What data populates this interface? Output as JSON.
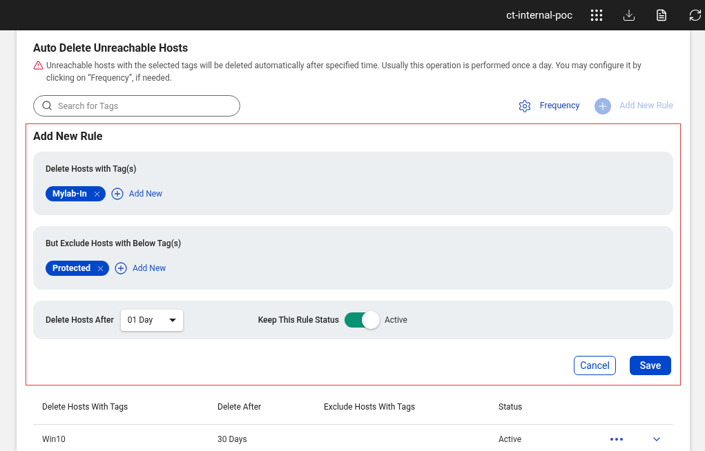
{
  "topbar": {
    "account": "ct-internal-poc"
  },
  "header": {
    "title": "Auto Delete Unreachable Hosts",
    "notice": "Unreachable hosts with the selected tags will be deleted automatically after specified time. Usually this operation is performed once a day. You may configure it by clicking on “Frequency”, if needed."
  },
  "search": {
    "placeholder": "Search for Tags"
  },
  "toolbar": {
    "frequency": "Frequency",
    "add_rule": {
      "label": "Add New Rule",
      "disabled": true
    }
  },
  "rule_form": {
    "title": "Add New Rule",
    "include_section": {
      "label": "Delete Hosts with Tag(s)",
      "tags": [
        "Mylab-In"
      ],
      "add_label": "Add New"
    },
    "exclude_section": {
      "label": "But Exclude Hosts with Below Tag(s)",
      "tags": [
        "Protected"
      ],
      "add_label": "Add New"
    },
    "delete_after": {
      "label": "Delete Hosts After",
      "value": "01 Day"
    },
    "status": {
      "label": "Keep This Rule Status",
      "on": true,
      "value": "Active"
    },
    "buttons": {
      "cancel": "Cancel",
      "save": "Save"
    }
  },
  "table": {
    "columns": [
      "Delete Hosts With Tags",
      "Delete After",
      "Exclude Hosts With Tags",
      "Status"
    ],
    "rows": [
      {
        "cells": [
          "Win10",
          "30 Days",
          "",
          "Active"
        ]
      }
    ]
  }
}
